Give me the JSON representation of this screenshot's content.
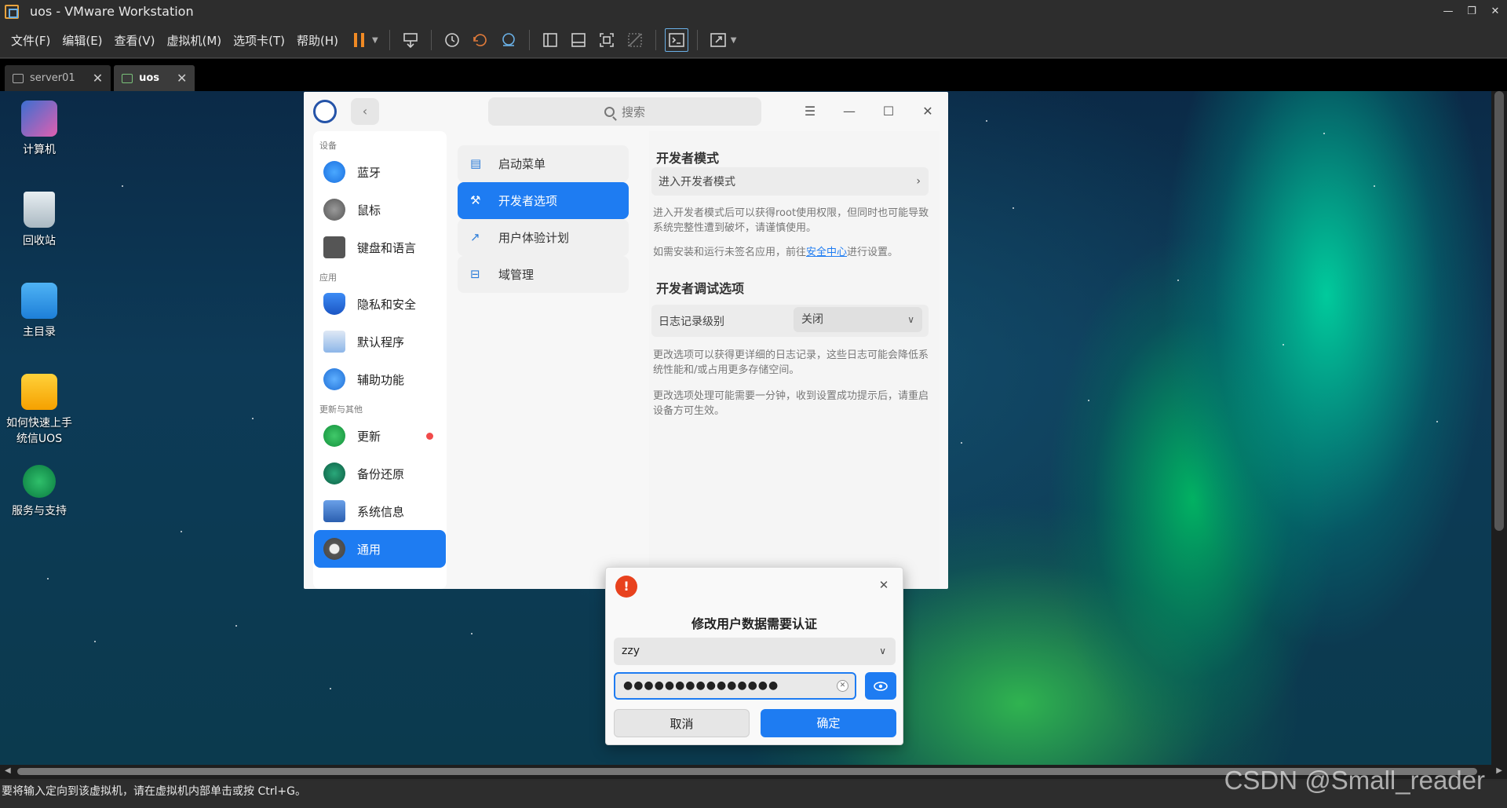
{
  "vmware": {
    "title": "uos - VMware Workstation",
    "menu": [
      "文件(F)",
      "编辑(E)",
      "查看(V)",
      "虚拟机(M)",
      "选项卡(T)",
      "帮助(H)"
    ],
    "tabs": [
      {
        "label": "server01",
        "active": false
      },
      {
        "label": "uos",
        "active": true
      }
    ],
    "status_text": "要将输入定向到该虚拟机，请在虚拟机内部单击或按 Ctrl+G。"
  },
  "desktop": {
    "icons": [
      {
        "label": "计算机",
        "icon": "computer-icon"
      },
      {
        "label": "回收站",
        "icon": "trash-icon"
      },
      {
        "label": "主目录",
        "icon": "home-folder-icon"
      },
      {
        "label": "如何快速上手统信UOS",
        "icon": "uos-guide-icon"
      },
      {
        "label": "服务与支持",
        "icon": "support-icon"
      }
    ]
  },
  "settings": {
    "search_placeholder": "搜索",
    "left_groups": {
      "devices": "设备",
      "apps": "应用",
      "updates": "更新与其他"
    },
    "left_items": {
      "bluetooth": "蓝牙",
      "mouse": "鼠标",
      "keyboard": "键盘和语言",
      "privacy": "隐私和安全",
      "default_apps": "默认程序",
      "accessibility": "辅助功能",
      "update": "更新",
      "backup": "备份还原",
      "sysinfo": "系统信息",
      "general": "通用"
    },
    "mid_items": {
      "boot_menu": "启动菜单",
      "developer": "开发者选项",
      "ux_plan": "用户体验计划",
      "domain": "域管理"
    },
    "right": {
      "dev_mode_title": "开发者模式",
      "enter_dev_mode": "进入开发者模式",
      "dev_mode_desc": "进入开发者模式后可以获得root使用权限，但同时也可能导致系统完整性遭到破坏，请谨慎使用。",
      "install_prefix": "如需安装和运行未签名应用，前往",
      "install_link": "安全中心",
      "install_suffix": "进行设置。",
      "debug_title": "开发者调试选项",
      "log_level_label": "日志记录级别",
      "log_level_value": "关闭",
      "log_desc": "更改选项可以获得更详细的日志记录，这些日志可能会降低系统性能和/或占用更多存储空间。",
      "log_note": "更改选项处理可能需要一分钟，收到设置成功提示后，请重启设备方可生效。"
    }
  },
  "auth_dialog": {
    "title": "修改用户数据需要认证",
    "username": "zzy",
    "password_mask": "●●●●●●●●●●●●●●●",
    "cancel": "取消",
    "confirm": "确定"
  },
  "watermark": "CSDN @Small_reader",
  "colors": {
    "accent": "#1e7cf2",
    "vm_chrome": "#2d2d2d",
    "alert": "#e8421e",
    "update_dot": "#f14a4a"
  }
}
